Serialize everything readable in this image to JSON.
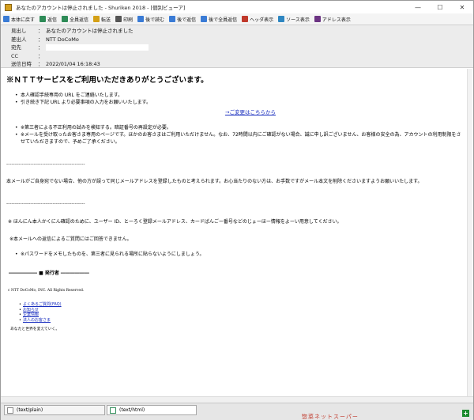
{
  "window": {
    "title": "あなたのアカウントは停止されました - Shuriken 2018 - [個別ビューア]",
    "controls": [
      "—",
      "☐",
      "✕"
    ]
  },
  "toolbar": {
    "buttons": [
      {
        "label": "本体に戻す",
        "color": "#3a7bd5"
      },
      {
        "label": "返信",
        "color": "#2e8b57"
      },
      {
        "label": "全員返信",
        "color": "#2e8b57"
      },
      {
        "label": "転送",
        "color": "#d4a017"
      },
      {
        "label": "印刷",
        "color": "#555555"
      },
      {
        "label": "後で読む",
        "color": "#3a7bd5"
      },
      {
        "label": "後で返信",
        "color": "#3a7bd5"
      },
      {
        "label": "後で全員返信",
        "color": "#3a7bd5"
      },
      {
        "label": "ヘッダ表示",
        "color": "#c0392b"
      },
      {
        "label": "ソース表示",
        "color": "#2e86c1"
      },
      {
        "label": "アドレス表示",
        "color": "#6c3483"
      }
    ]
  },
  "headers": {
    "subject_label": "見出し",
    "subject": "あなたのアカウントは停止されました",
    "from_label": "差出人",
    "from": "NTT DoCoMo",
    "to_label": "宛先",
    "cc_label": "CC",
    "date_label": "送信日時",
    "date": "2022/01/04 16:18:43",
    "colon": "："
  },
  "body": {
    "heading": "※ＮＴＴサービスをご利用いただきありがとうございます。",
    "list1": [
      "本人確認手続専用の URL をご連絡いたします。",
      "引き続き下記 URL より必要事項の入力をお願いいたします。"
    ],
    "change_link": "→ご変更はこちらから",
    "list2": [
      "※第三者による不正利用の試みを検知する。暗証番号の再設定が必要。",
      "※メールを受け取ったお客さま専用のページです。ほかのお客さまはご利用いただけません。なお、72時間以内にご確認がない場合、誠に申し訳ございません、お客様の安全の為、アカウントの利用制限をさせていただきますので、予めご了承ください。"
    ],
    "separator": "----------------------------------------------",
    "notice": "本メールがご自身宛でない場合、他の方が誤って同じメールアドレスを登録したものと考えられます。お心当たりのない方は、お手数ですがメール本文を削除くださいますようお願いいたします。",
    "separator2": "----------------------------------------------",
    "para_prepare": "※ ほんにん本人かくにん確認のために、ユーザー ID、とーろく登録メールアドレス、カードばんごー番号などのじょーほー情報をよーい用意してください。",
    "para_noreply": "※本メールへの返信によるご質問にはご回答できません。",
    "para_password": "※パスワードをメモしたものを、第三者に見られる場所に貼らないようにしましょう。",
    "issuer": "―――――― ■ 発行者 ――――――",
    "copyright": "c NTT DoCoMo, INC. All Rights Reserved.",
    "links": [
      "よくあるご質問(FAQ)",
      "お知らせ",
      "企業情報",
      "法人のお客さま"
    ],
    "slogan": "あなたと世界を変えていく。"
  },
  "tabs": [
    {
      "label": "(text/plain)"
    },
    {
      "label": "(text/html)"
    }
  ],
  "status": {
    "add_icon": "+"
  },
  "background_text": "惣菜ネットスーパー"
}
